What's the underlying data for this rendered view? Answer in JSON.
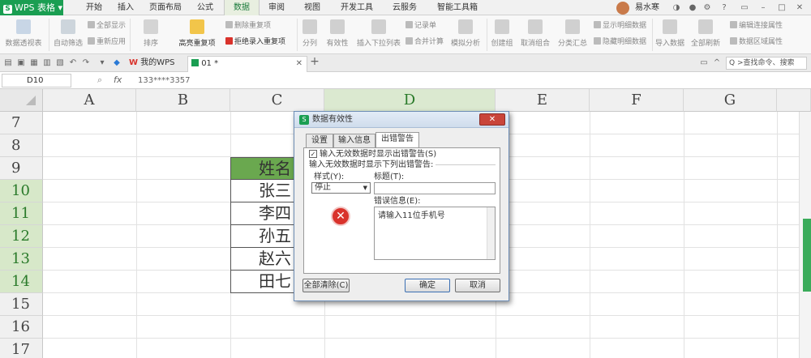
{
  "app": {
    "name": "WPS 表格",
    "logo_letter": "S"
  },
  "menu_tabs": [
    "开始",
    "插入",
    "页面布局",
    "公式",
    "数据",
    "审阅",
    "视图",
    "开发工具",
    "云服务",
    "智能工具箱"
  ],
  "active_menu": "数据",
  "user": {
    "name": "易水寒"
  },
  "ribbon": {
    "buttons": [
      "数据透视表",
      "自动筛选",
      "排序",
      "高亮重复项",
      "分列",
      "有效性",
      "插入下拉列表",
      "模拟分析",
      "创建组",
      "取消组合",
      "分类汇总",
      "导入数据",
      "全部刷新"
    ],
    "small": [
      "全部显示",
      "重新应用",
      "删除重复项",
      "拒绝录入重复项",
      "记录单",
      "合并计算",
      "显示明细数据",
      "隐藏明细数据",
      "编辑连接属性",
      "数据区域属性"
    ]
  },
  "doc_tabs": {
    "home": "我的WPS",
    "current": "01 *",
    "add": "+"
  },
  "search": {
    "placeholder": "Q >查找命令、搜索"
  },
  "formula_bar": {
    "cell_ref": "D10",
    "fx": "fx",
    "value": "133****3357"
  },
  "columns": [
    "A",
    "B",
    "C",
    "D",
    "E",
    "F",
    "G"
  ],
  "rows": [
    "7",
    "8",
    "9",
    "10",
    "11",
    "12",
    "13",
    "14",
    "15",
    "16",
    "17"
  ],
  "cells": {
    "header": "姓名",
    "names": [
      "张三",
      "李四",
      "孙五",
      "赵六",
      "田七"
    ]
  },
  "dialog": {
    "title": "数据有效性",
    "close": "✕",
    "tabs": [
      "设置",
      "输入信息",
      "出错警告"
    ],
    "active_tab": "出错警告",
    "show_error_checkbox": "输入无效数据时显示出错警告(S)",
    "group_label": "输入无效数据时显示下列出错警告:",
    "style_label": "样式(Y):",
    "style_value": "停止",
    "title_label": "标题(T):",
    "title_value": "",
    "message_label": "错误信息(E):",
    "message_value": "请输入11位手机号",
    "clear_all": "全部清除(C)",
    "ok": "确定",
    "cancel": "取消"
  },
  "colors": {
    "brand": "#1a9e52",
    "header_fill": "#6aa84f",
    "selection": "#d7e8c9"
  }
}
